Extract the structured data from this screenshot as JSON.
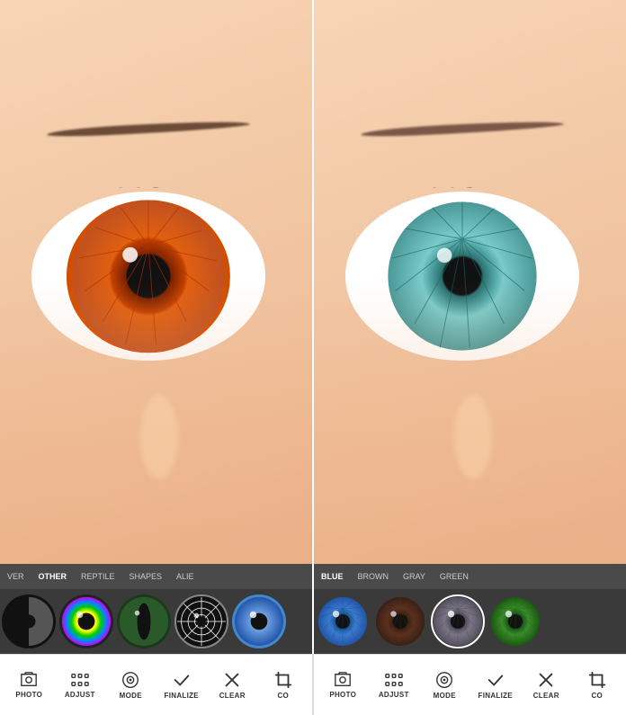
{
  "panels": [
    {
      "id": "left",
      "lens_type": "orange",
      "categories": [
        "VER",
        "OTHER",
        "REPTILE",
        "SHAPES",
        "ALIE"
      ],
      "active_category": "SHAPES",
      "lens_options": [
        {
          "id": "cut",
          "label": "cut",
          "type": "half-black"
        },
        {
          "id": "rainbow",
          "label": "rainbow",
          "type": "rainbow"
        },
        {
          "id": "reptile",
          "label": "reptile",
          "type": "reptile"
        },
        {
          "id": "spider",
          "label": "spider",
          "type": "spider"
        },
        {
          "id": "alien",
          "label": "alien",
          "type": "alien-blue"
        }
      ]
    },
    {
      "id": "right",
      "lens_type": "teal",
      "categories": [
        "BLUE",
        "BROWN",
        "GRAY",
        "GREEN"
      ],
      "active_category": "GRAY",
      "lens_options": [
        {
          "id": "blue1",
          "label": "blue",
          "type": "blue-iris"
        },
        {
          "id": "brown1",
          "label": "brown",
          "type": "brown-iris"
        },
        {
          "id": "gray1",
          "label": "gray",
          "type": "gray-iris"
        },
        {
          "id": "green1",
          "label": "green",
          "type": "green-iris"
        }
      ]
    }
  ],
  "toolbar": {
    "tools": [
      {
        "id": "photo",
        "label": "PHOTO",
        "icon": "photo"
      },
      {
        "id": "adjust",
        "label": "ADJUST",
        "icon": "adjust"
      },
      {
        "id": "mode",
        "label": "MODE",
        "icon": "mode"
      },
      {
        "id": "finalize",
        "label": "FINALIZE",
        "icon": "check"
      },
      {
        "id": "clear",
        "label": "CLEAR",
        "icon": "close"
      },
      {
        "id": "crop",
        "label": "CO",
        "icon": "crop"
      }
    ]
  }
}
